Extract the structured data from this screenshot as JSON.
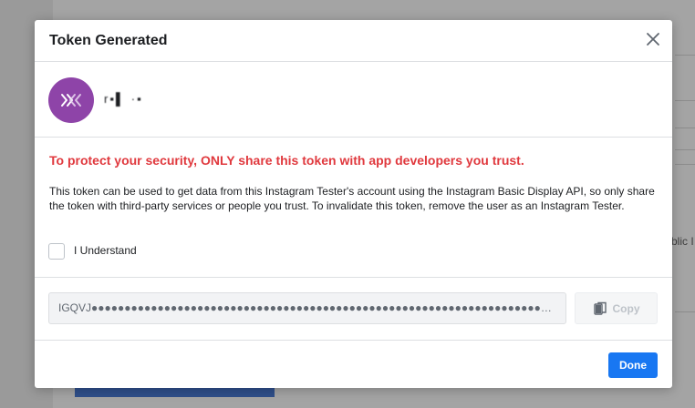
{
  "background": {
    "partial_text": "blic I"
  },
  "modal": {
    "title": "Token Generated",
    "close_icon": "close-icon",
    "user": {
      "avatar_icon": "app-logo-icon",
      "name_redacted": "r▪▌ ·▪"
    },
    "warning": "To protect your security, ONLY share this token with app developers you trust.",
    "description": "This token can be used to get data from this Instagram Tester's account using the Instagram Basic Display API, so only share the token with third-party services or people you trust. To invalidate this token, remove the user as an Instagram Tester.",
    "checkbox": {
      "label": "I Understand",
      "checked": false
    },
    "token": {
      "value": "IGQVJ●●●●●●●●●●●●●●●●●●●●●●●●●●●●●●●●●●●●●●●●●●●●●●●●●●●●●●●●●●●●●●●●●●●●●●●●●●●●●●●●●●●●●●●●●●●●●●●●●●..."
    },
    "copy_button": {
      "label": "Copy",
      "icon": "copy-icon",
      "enabled": false
    },
    "done_button": {
      "label": "Done"
    }
  },
  "colors": {
    "warning": "#e0393e",
    "primary": "#1877f2",
    "avatar": "#8e44a8"
  }
}
